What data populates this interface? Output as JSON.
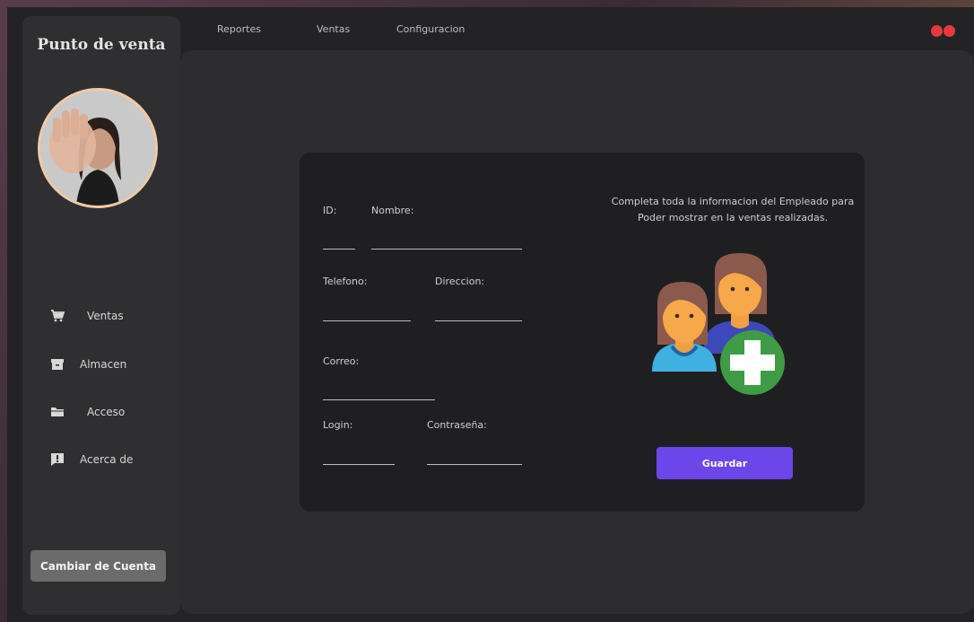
{
  "app": {
    "title": "Punto de venta"
  },
  "top_menu": [
    "Reportes",
    "Ventas",
    "Configuracion"
  ],
  "sidebar": {
    "items": [
      {
        "label": "Ventas",
        "icon": "cart-icon"
      },
      {
        "label": "Almacen",
        "icon": "archive-icon"
      },
      {
        "label": "Acceso",
        "icon": "folder-icon"
      },
      {
        "label": "Acerca de",
        "icon": "alert-icon"
      }
    ],
    "switch_account": "Cambiar de Cuenta"
  },
  "form": {
    "id_label": "ID:",
    "nombre_label": "Nombre:",
    "telefono_label": "Telefono:",
    "direccion_label": "Direccion:",
    "correo_label": "Correo:",
    "login_label": "Login:",
    "password_label": "Contraseña:",
    "info_line1": "Completa toda la informacion del Empleado para",
    "info_line2": "Poder mostrar en la ventas realizadas.",
    "save_label": "Guardar"
  },
  "colors": {
    "accent": "#6c46e8",
    "window_control": "#e5393e",
    "avatar_border": "#f2c9a6",
    "add_badge": "#3f9b45"
  }
}
